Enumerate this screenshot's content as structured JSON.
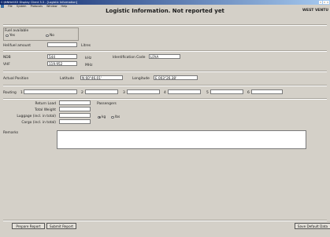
{
  "window": {
    "title": "C:\\NNNASS3 Display Client 3.3 - [Logistic Information]",
    "menu": [
      "File",
      "System",
      "Protocols",
      "Window",
      "Help"
    ]
  },
  "header": {
    "title": "Logistic Information. Not reported yet",
    "right_label": "WEST VENTU"
  },
  "fuel": {
    "label": "Fuel available",
    "options": [
      "Yes",
      "No"
    ],
    "selected": "none"
  },
  "helifuel": {
    "label": "Helifuel amount",
    "value": "",
    "unit": "Litres"
  },
  "navigation": {
    "ndb_label": "NDB",
    "ndb_value": "544",
    "ndb_unit": "kHz",
    "vhf_label": "VHF",
    "vhf_value": "119.952",
    "vhf_unit": "MHz",
    "id_code_label": "Identification Code",
    "id_code_value": "LFAA"
  },
  "position": {
    "label": "Actual Position",
    "lat_label": "Latitude",
    "lat_value": "N 60°46.01'",
    "lon_label": "Longitude",
    "lon_value": "E 003°26.38'"
  },
  "routing": {
    "label": "Routing",
    "points": [
      {
        "num": "1",
        "value": ""
      },
      {
        "num": "2",
        "value": ""
      },
      {
        "num": "3",
        "value": ""
      },
      {
        "num": "4",
        "value": ""
      },
      {
        "num": "5",
        "value": ""
      },
      {
        "num": "6",
        "value": ""
      }
    ]
  },
  "load": {
    "return_load_label": "Return Load",
    "total_weight_label": "Total Weight",
    "luggage_label": "Luggage (incl. in total)",
    "cargo_label": "Cargo (incl. in total)",
    "passengers_label": "Passengers",
    "unit_options": [
      "kg",
      "lbs"
    ],
    "selected_unit": "kg"
  },
  "remarks": {
    "label": "Remarks",
    "value": ""
  },
  "buttons": {
    "prepare": "Prepare Report",
    "submit": "Submit Report",
    "save_default": "Save Default Data"
  }
}
